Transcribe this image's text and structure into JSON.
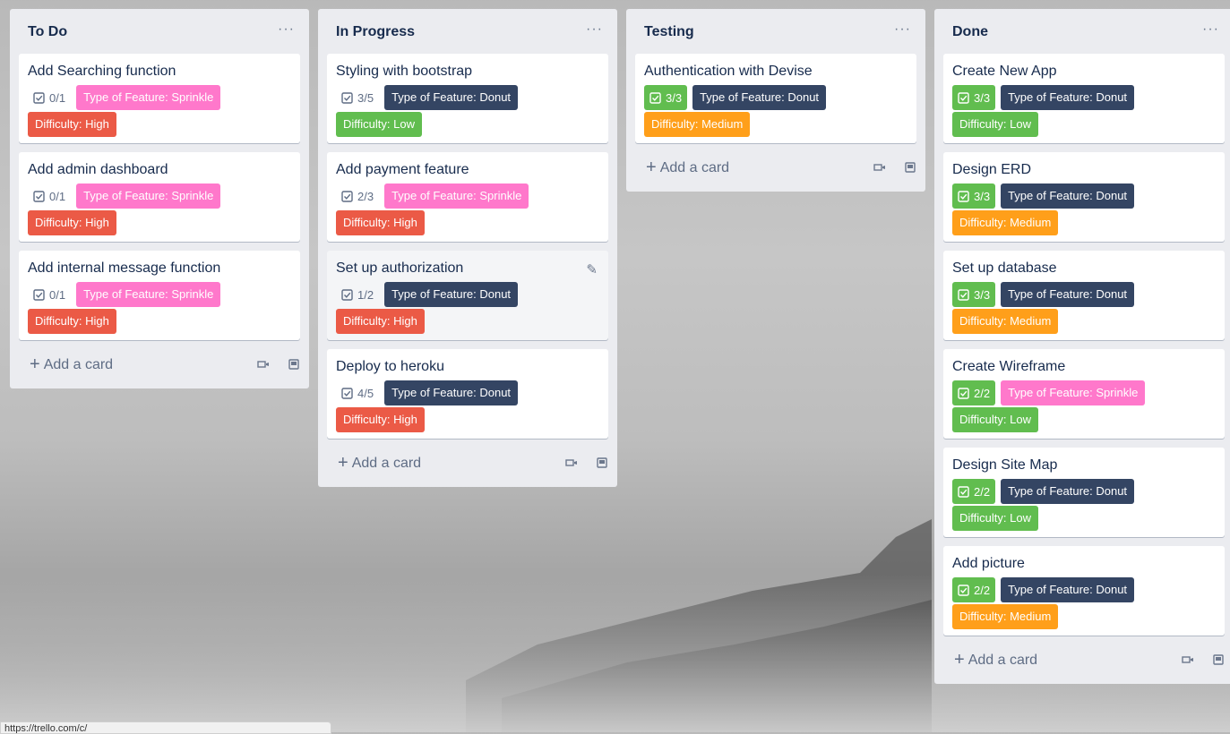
{
  "lists": [
    {
      "title": "To Do",
      "menu": "···",
      "add_card": "Add a card",
      "cards": [
        {
          "title": "Add Searching function",
          "checklist": "0/1",
          "checklist_complete": false,
          "labels": [
            "Type of Feature: Sprinkle",
            "Difficulty: High"
          ]
        },
        {
          "title": "Add admin dashboard",
          "checklist": "0/1",
          "checklist_complete": false,
          "labels": [
            "Type of Feature: Sprinkle",
            "Difficulty: High"
          ]
        },
        {
          "title": "Add internal message function",
          "checklist": "0/1",
          "checklist_complete": false,
          "labels": [
            "Type of Feature: Sprinkle",
            "Difficulty: High"
          ]
        }
      ]
    },
    {
      "title": "In Progress",
      "menu": "···",
      "add_card": "Add a card",
      "cards": [
        {
          "title": "Styling with bootstrap",
          "checklist": "3/5",
          "checklist_complete": false,
          "labels": [
            "Type of Feature: Donut",
            "Difficulty: Low"
          ]
        },
        {
          "title": "Add payment feature",
          "checklist": "2/3",
          "checklist_complete": false,
          "labels": [
            "Type of Feature: Sprinkle",
            "Difficulty: High"
          ]
        },
        {
          "title": "Set up authorization",
          "checklist": "1/2",
          "checklist_complete": false,
          "labels": [
            "Type of Feature: Donut",
            "Difficulty: High"
          ]
        },
        {
          "title": "Deploy to heroku",
          "checklist": "4/5",
          "checklist_complete": false,
          "labels": [
            "Type of Feature: Donut",
            "Difficulty: High"
          ]
        }
      ]
    },
    {
      "title": "Testing",
      "menu": "···",
      "add_card": "Add a card",
      "cards": [
        {
          "title": "Authentication with Devise",
          "checklist": "3/3",
          "checklist_complete": true,
          "labels": [
            "Type of Feature: Donut",
            "Difficulty: Medium"
          ]
        }
      ]
    },
    {
      "title": "Done",
      "menu": "···",
      "add_card": "Add a card",
      "cards": [
        {
          "title": "Create New App",
          "checklist": "3/3",
          "checklist_complete": true,
          "labels": [
            "Type of Feature: Donut",
            "Difficulty: Low"
          ]
        },
        {
          "title": "Design ERD",
          "checklist": "3/3",
          "checklist_complete": true,
          "labels": [
            "Type of Feature: Donut",
            "Difficulty: Medium"
          ]
        },
        {
          "title": "Set up database",
          "checklist": "3/3",
          "checklist_complete": true,
          "labels": [
            "Type of Feature: Donut",
            "Difficulty: Medium"
          ]
        },
        {
          "title": "Create Wireframe",
          "checklist": "2/2",
          "checklist_complete": true,
          "labels": [
            "Type of Feature: Sprinkle",
            "Difficulty: Low"
          ]
        },
        {
          "title": "Design Site Map",
          "checklist": "2/2",
          "checklist_complete": true,
          "labels": [
            "Type of Feature: Donut",
            "Difficulty: Low"
          ]
        },
        {
          "title": "Add picture",
          "checklist": "2/2",
          "checklist_complete": true,
          "labels": [
            "Type of Feature: Donut",
            "Difficulty: Medium"
          ]
        }
      ]
    }
  ],
  "label_colors": {
    "Type of Feature: Sprinkle": "#ff78cb",
    "Type of Feature: Donut": "#344563",
    "Difficulty: High": "#eb5a46",
    "Difficulty: Low": "#61bd4f",
    "Difficulty: Medium": "#ff9f1a"
  },
  "icons": {
    "list_menu": "ellipsis-icon",
    "checklist": "checkbox-icon",
    "add": "plus-icon",
    "template": "card-template-icon",
    "edit": "pencil-icon"
  },
  "statusbar": {
    "text": "https://trello.com/c/"
  }
}
